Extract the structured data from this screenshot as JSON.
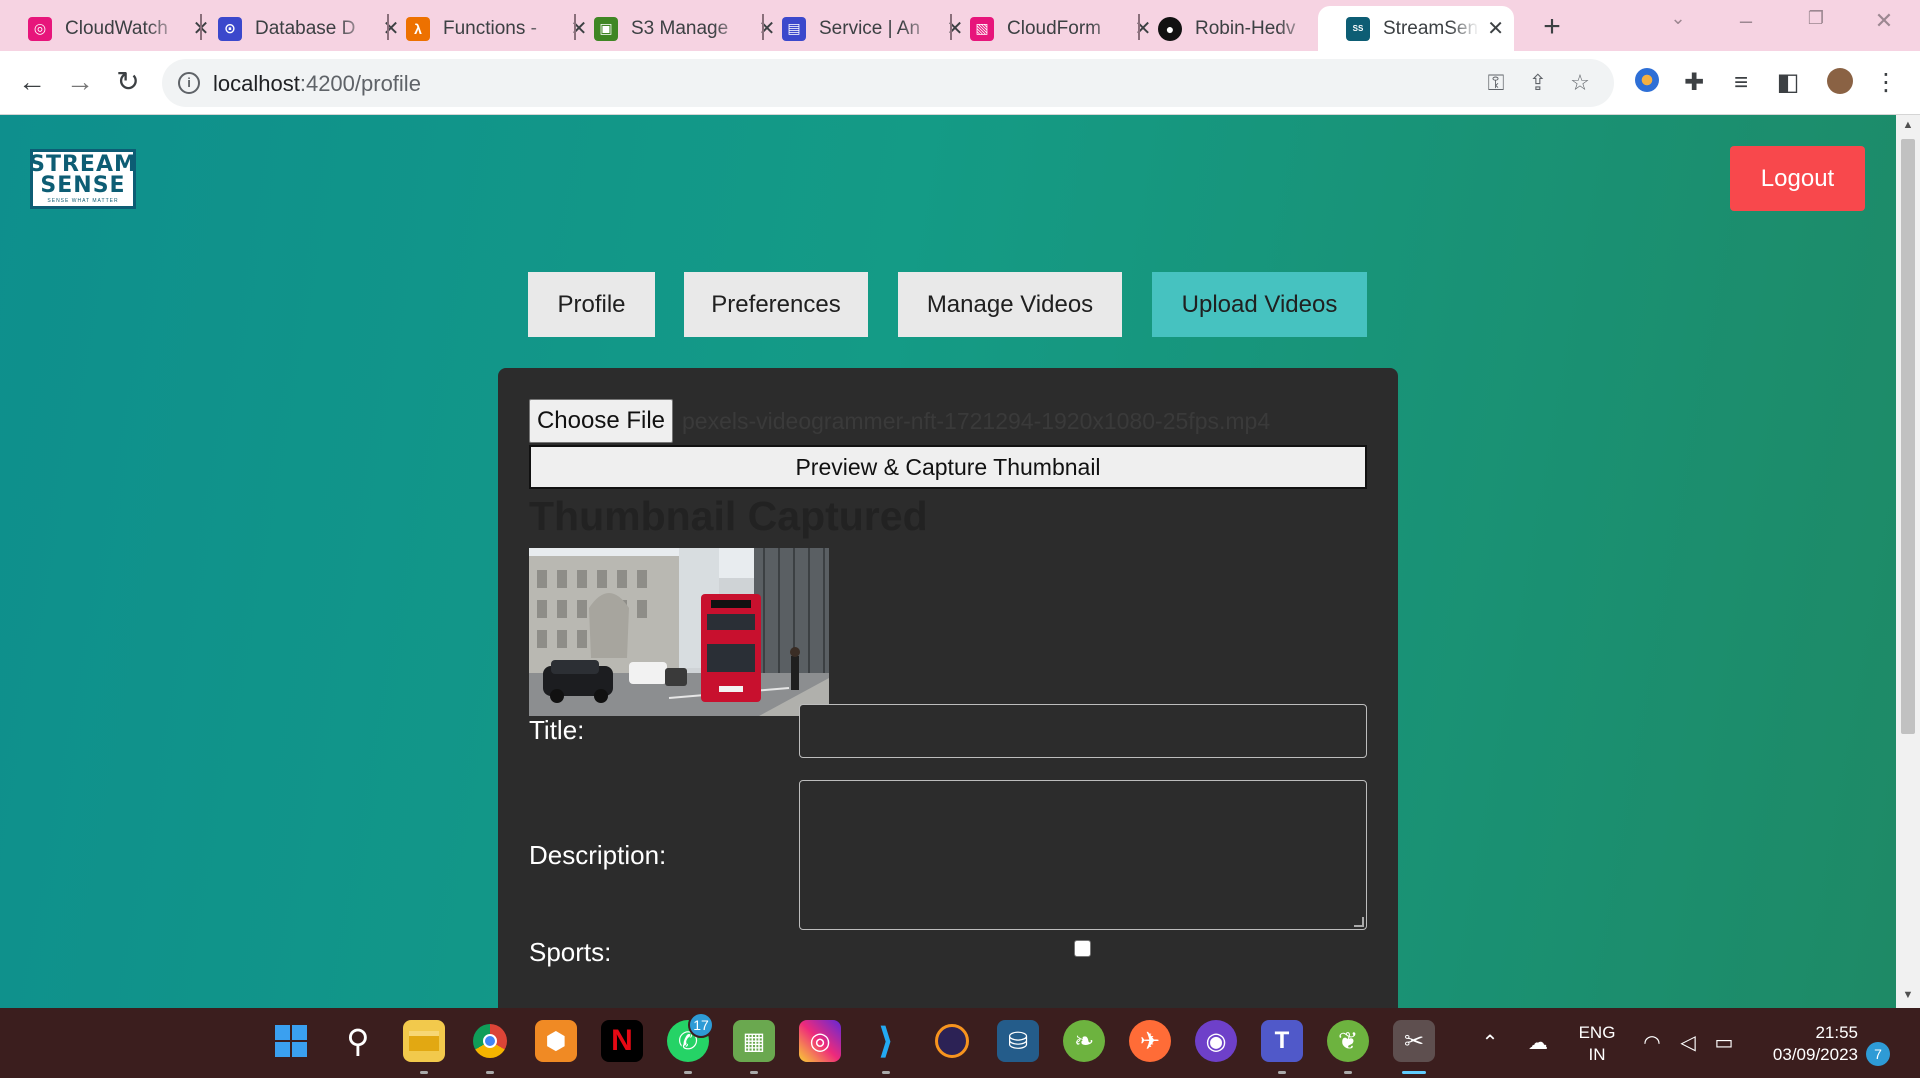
{
  "browser": {
    "tabs": [
      {
        "label": "CloudWatch",
        "icon": "cloudwatch-icon",
        "color": "#e7157b"
      },
      {
        "label": "Database D",
        "icon": "database-icon",
        "color": "#3b48cc"
      },
      {
        "label": "Functions -",
        "icon": "lambda-icon",
        "color": "#ed7100"
      },
      {
        "label": "S3 Manage",
        "icon": "s3-icon",
        "color": "#3f8624"
      },
      {
        "label": "Service | An",
        "icon": "service-icon",
        "color": "#3b48cc"
      },
      {
        "label": "CloudForm",
        "icon": "cloudformation-icon",
        "color": "#e7157b"
      },
      {
        "label": "Robin-Hedv",
        "icon": "github-icon",
        "color": "#111111"
      },
      {
        "label": "StreamSens",
        "icon": "streamsense-icon",
        "color": "#0d5d74"
      }
    ],
    "url_host": "localhost",
    "url_path": ":4200/profile"
  },
  "header": {
    "logo_line1": "STREAM",
    "logo_line2": "SENSE",
    "logo_tagline": "SENSE WHAT MATTER",
    "logout_label": "Logout"
  },
  "nav": {
    "tabs": [
      {
        "label": "Profile",
        "active": false
      },
      {
        "label": "Preferences",
        "active": false
      },
      {
        "label": "Manage Videos",
        "active": false
      },
      {
        "label": "Upload Videos",
        "active": true
      }
    ]
  },
  "upload": {
    "choose_file_label": "Choose File",
    "file_name": "pexels-videogrammer-nft-1721294-1920x1080-25fps.mp4",
    "capture_label": "Preview & Capture Thumbnail",
    "thumbnail_heading": "Thumbnail Captured",
    "title_label": "Title:",
    "title_value": "",
    "description_label": "Description:",
    "description_value": "",
    "sports_label": "Sports:",
    "sports_checked": false
  },
  "taskbar": {
    "whatsapp_badge": "17",
    "language_line1": "ENG",
    "language_line2": "IN",
    "time": "21:55",
    "date": "03/09/2023",
    "notification_count": "7"
  },
  "colors": {
    "accent": "#46c2c0",
    "logout": "#f8484c",
    "panel": "#2c2c2c"
  }
}
